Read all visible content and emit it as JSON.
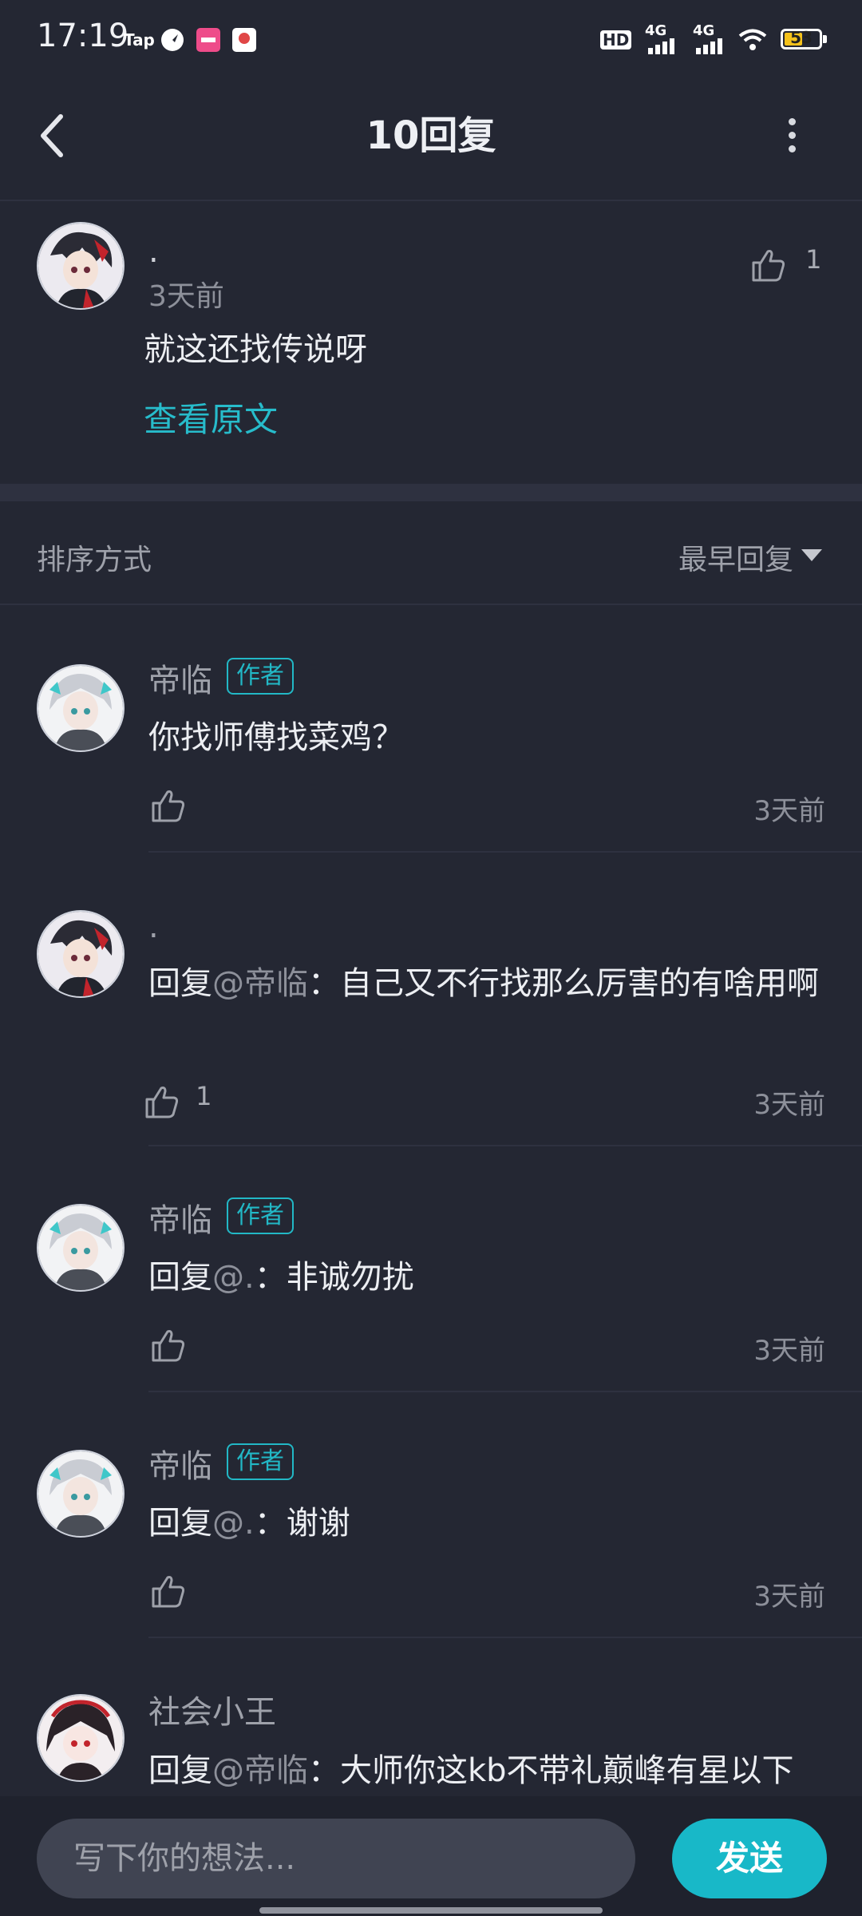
{
  "status_bar": {
    "time": "17:19",
    "battery": "53",
    "battery_fraction": 0.53,
    "network_1": "4G",
    "network_2": "4G",
    "hd": "HD",
    "app_icons": [
      "tap-icon",
      "compass-icon",
      "lofter-icon",
      "map-pin-icon"
    ]
  },
  "header": {
    "title": "10回复",
    "back_icon": "chevron-left-icon",
    "more_icon": "more-vertical-icon"
  },
  "original": {
    "name": ".",
    "time": "3天前",
    "text": "就这还找传说呀",
    "link": "查看原文",
    "likes": "1"
  },
  "sort": {
    "label": "排序方式",
    "value": "最早回复"
  },
  "replies": [
    {
      "name": "帝临",
      "badge": "作者",
      "prefix": "",
      "at": "",
      "text": "你找师傅找菜鸡？",
      "likes": "",
      "time": "3天前"
    },
    {
      "name": ".",
      "badge": "",
      "prefix": "回复",
      "at": "@帝临",
      "text": "：自己又不行找那么厉害的有啥用啊",
      "likes": "1",
      "time": "3天前"
    },
    {
      "name": "帝临",
      "badge": "作者",
      "prefix": "回复",
      "at": "@.",
      "text": "：非诚勿扰",
      "likes": "",
      "time": "3天前"
    },
    {
      "name": "帝临",
      "badge": "作者",
      "prefix": "回复",
      "at": "@.",
      "text": "：谢谢",
      "likes": "",
      "time": "3天前"
    },
    {
      "name": "社会小王",
      "badge": "",
      "prefix": "回复",
      "at": "@帝临",
      "text": "：大师你这kb不带礼巅峰有星以下",
      "likes": "",
      "time": ""
    }
  ],
  "composer": {
    "placeholder": "写下你的想法...",
    "send_label": "发送"
  },
  "colors": {
    "background": "#242733",
    "accent": "#18b8c8",
    "badge": "#22b8c6"
  }
}
